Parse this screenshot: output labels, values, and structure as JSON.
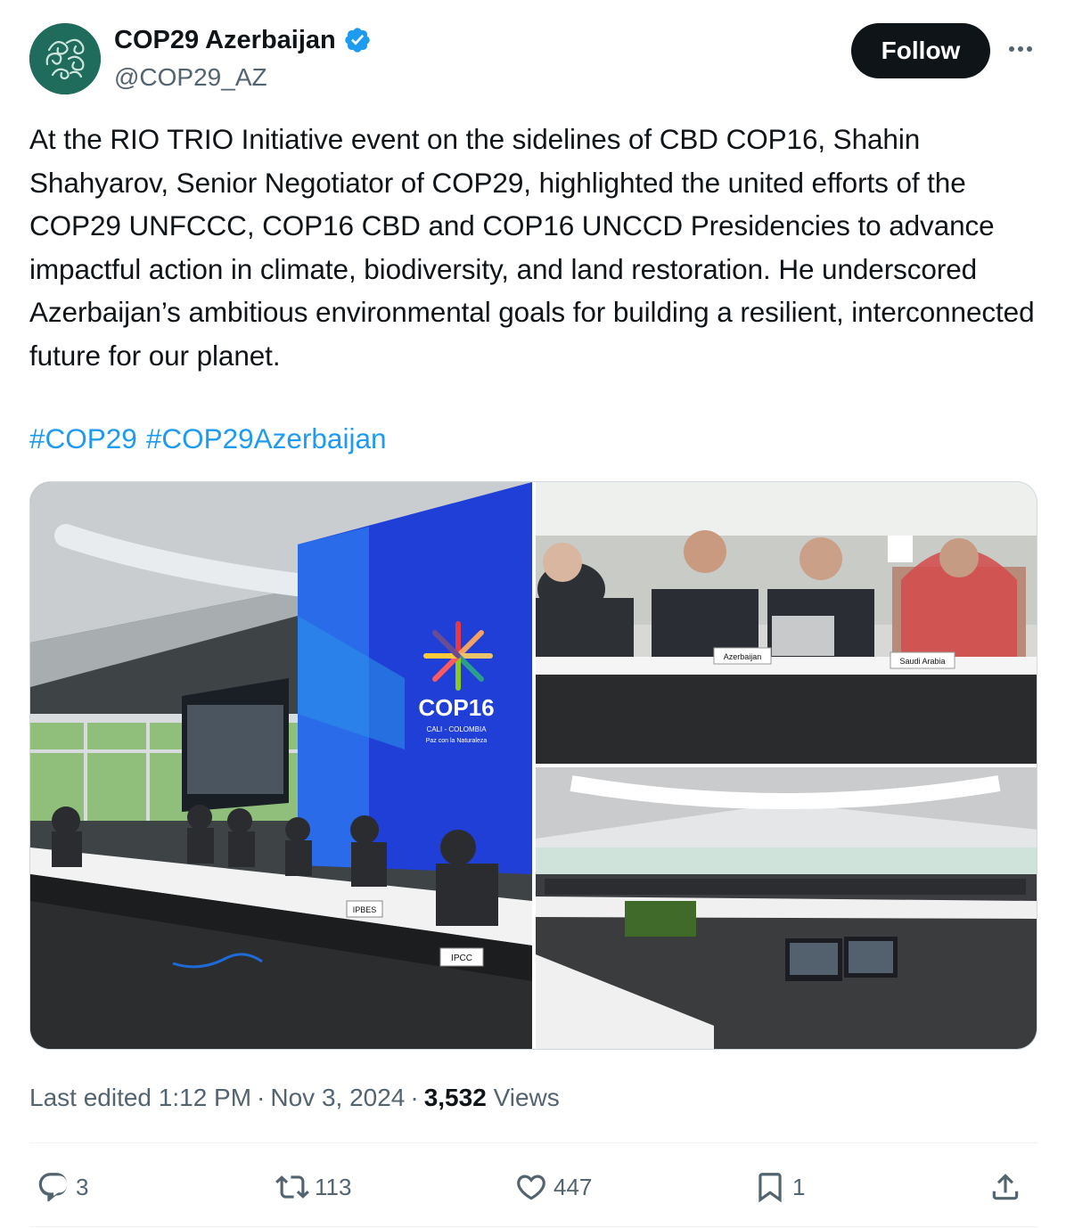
{
  "author": {
    "display_name": "COP29 Azerbaijan",
    "handle": "@COP29_AZ",
    "verified": true,
    "avatar_icon": "cop29-logo-icon",
    "avatar_color": "#1f6b5c"
  },
  "header": {
    "follow_label": "Follow",
    "more_icon": "more-icon"
  },
  "tweet": {
    "text": "At the RIO TRIO Initiative event on the sidelines of CBD COP16, Shahin Shahyarov, Senior Negotiator of COP29, highlighted the united efforts of the COP29 UNFCCC, COP16 CBD and COP16 UNCCD Presidencies to advance impactful action in climate, biodiversity, and land restoration. He underscored Azerbaijan’s ambitious environmental goals for building a resilient, interconnected future for our planet.",
    "hashtags": [
      "#COP29",
      "#COP29Azerbaijan"
    ],
    "link_color": "#1d9bf0"
  },
  "media": {
    "photos": [
      {
        "stage_logo": "COP16",
        "stage_logo_sub1": "CALI - COLOMBIA",
        "stage_logo_sub2": "Paz con la Naturaleza",
        "desk_signs": [
          "IPBES",
          "IPCC"
        ]
      },
      {
        "desk_signs": [
          "Azerbaijan",
          "Saudi Arabia"
        ]
      },
      {}
    ]
  },
  "meta": {
    "edited_label": "Last edited 1:12 PM",
    "date": "Nov 3, 2024",
    "views_count": "3,532",
    "views_label": "Views"
  },
  "actions": {
    "replies": "3",
    "reposts": "113",
    "likes": "447",
    "bookmarks": "1"
  }
}
